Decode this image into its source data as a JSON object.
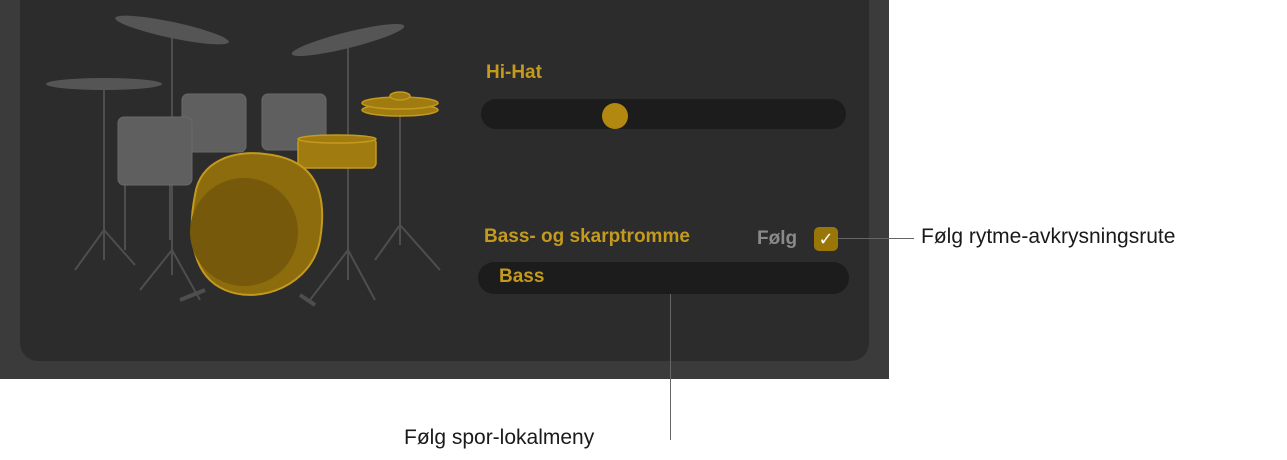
{
  "hihat": {
    "label": "Hi-Hat",
    "level": 0.35
  },
  "bass_snare": {
    "label": "Bass- og skarptromme",
    "follow_label": "Følg",
    "follow_checked": true,
    "popup_value": "Bass"
  },
  "callouts": {
    "follow_checkbox": "Følg rytme-avkrysningsrute",
    "follow_track_popup": "Følg spor-lokalmeny"
  },
  "colors": {
    "accent_gold": "#c49a1e",
    "panel_bg": "#2c2c2c",
    "outer_bg": "#3b3b3b",
    "drum_gray": "#5f5f5f"
  }
}
